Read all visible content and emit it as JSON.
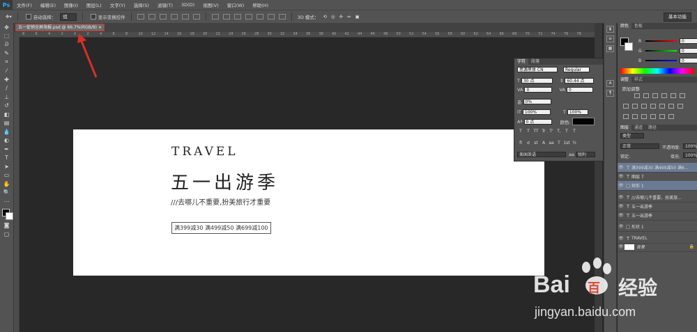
{
  "app": {
    "logo": "Ps"
  },
  "menu": [
    "文件(F)",
    "编辑(E)",
    "图像(I)",
    "图层(L)",
    "文字(Y)",
    "选择(S)",
    "滤镜(T)",
    "3D(D)",
    "视图(V)",
    "窗口(W)",
    "帮助(H)"
  ],
  "options": {
    "auto_select_label": "自动选择：",
    "auto_select_value": "组",
    "show_transform_label": "显示变换控件",
    "mode_3d_label": "3D 模式：",
    "workspace": "基本功能"
  },
  "document": {
    "tab_title": "五一促销全屏海报.psd @ 66.7%(RGB/8)",
    "close": "×"
  },
  "ruler": {
    "ticks": [
      "8",
      "6",
      "4",
      "2",
      "0",
      "2",
      "4",
      "6",
      "8",
      "10",
      "12",
      "14",
      "16",
      "18",
      "20",
      "22",
      "24",
      "26",
      "28",
      "30",
      "32",
      "34",
      "36",
      "38",
      "40",
      "42",
      "44",
      "46",
      "48",
      "50",
      "52",
      "54",
      "56",
      "58",
      "60",
      "62",
      "64",
      "66",
      "68",
      "70",
      "72",
      "74",
      "76",
      "78"
    ]
  },
  "poster": {
    "travel": "TRAVEL",
    "title": "五一出游季",
    "subtitle": "///去哪儿不重要,扮美旅行才重要",
    "promo": "满399减30 满499减50 满699减100"
  },
  "character_panel": {
    "tabs": [
      "字符",
      "段落"
    ],
    "font_family": "思源黑体 CN",
    "font_style": "Regular",
    "font_size": "30 点",
    "leading": "60.44 点",
    "kerning": "0",
    "tracking": "0",
    "scale_pct": "0%",
    "vscale": "100%",
    "hscale": "100%",
    "baseline": "0 点",
    "color_label": "颜色:",
    "format_buttons": [
      "T",
      "T",
      "TT",
      "Tr",
      "T'",
      "T,",
      "T",
      "T"
    ],
    "opentype_buttons": [
      "fi",
      "σ",
      "st",
      "A",
      "aa",
      "T",
      "1st",
      "½"
    ],
    "language": "美国英语",
    "aa_label": "aa",
    "antialias": "锐利"
  },
  "color_panel": {
    "tabs": [
      "颜色",
      "色板"
    ],
    "channels": [
      {
        "label": "R",
        "value": "0"
      },
      {
        "label": "G",
        "value": "0"
      },
      {
        "label": "B",
        "value": "0"
      }
    ]
  },
  "adjustments_panel": {
    "tabs": [
      "调整",
      "样式"
    ],
    "title": "添加调整"
  },
  "layers_panel": {
    "tabs": [
      "图层",
      "通道",
      "路径"
    ],
    "filter": "类型",
    "blend_mode": "正常",
    "opacity_label": "不透明度:",
    "opacity": "100%",
    "lock_label": "锁定:",
    "fill_label": "填充:",
    "fill": "100%",
    "layers": [
      {
        "name": "满399减30 满499减50 满6...",
        "type": "T",
        "selected": true
      },
      {
        "name": "图层 7",
        "type": "T",
        "selected": false
      },
      {
        "name": "矩形 1",
        "type": "▢",
        "selected": true
      },
      {
        "name": "///去哪儿不重要，扮美旅...",
        "type": "T",
        "selected": false
      },
      {
        "name": "五一出游季",
        "type": "T",
        "selected": false
      },
      {
        "name": "五一出游季",
        "type": "T",
        "selected": false
      },
      {
        "name": "形状 1",
        "type": "▢",
        "selected": false
      },
      {
        "name": "TRAVEL",
        "type": "T",
        "selected": false
      },
      {
        "name": "背景",
        "type": "",
        "selected": false
      }
    ]
  },
  "watermark": {
    "brand": "Bai",
    "brand2": "百",
    "jingyan": "经验",
    "url": "jingyan.baidu.com"
  },
  "colors": {
    "accent_red": "#c7362e",
    "ui_dark": "#282828",
    "ui_panel": "#535353"
  }
}
